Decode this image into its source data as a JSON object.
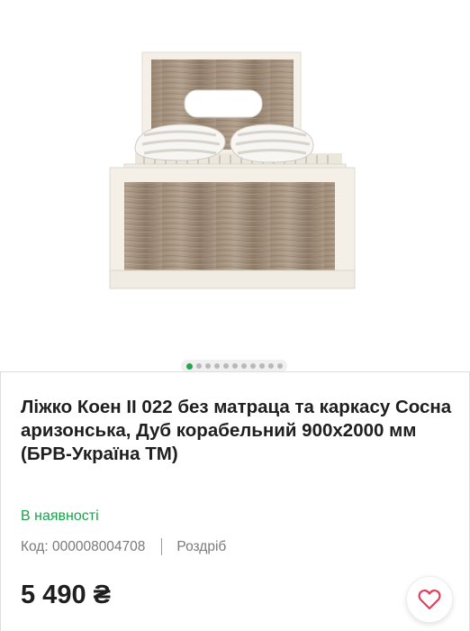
{
  "gallery": {
    "image_alt": "bed-product-photo",
    "slide_count": 11,
    "active_slide": 1
  },
  "product": {
    "title": "Ліжко Коен ІІ 022 без матраца та каркасу Сосна аризонська, Дуб корабельний 900х2000 мм (БРВ-Україна ТМ)",
    "availability": "В наявності",
    "code_label": "Код:",
    "code": "000008004708",
    "code_text": "Код: 000008004708",
    "sale_type": "Роздріб",
    "price": "5 490 ₴"
  },
  "colors": {
    "accent_green": "#1aa34a",
    "wishlist_icon": "#e0405a"
  },
  "icons": {
    "wishlist": "heart-icon"
  }
}
